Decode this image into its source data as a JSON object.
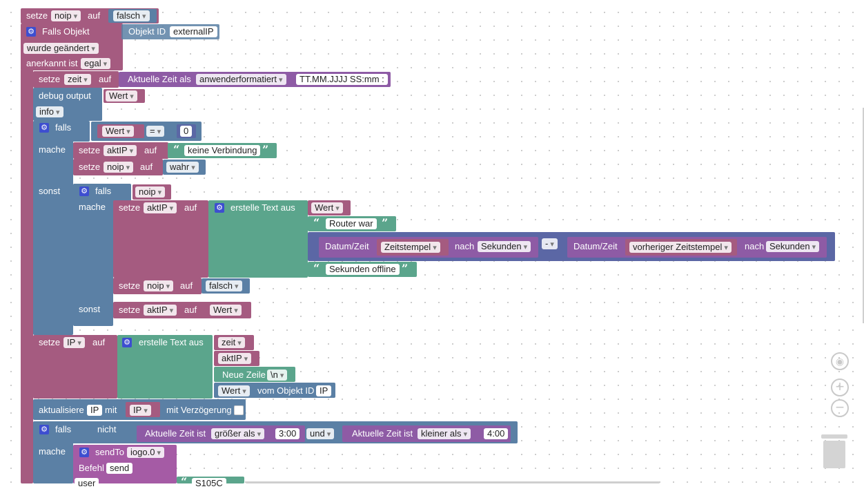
{
  "blocks": {
    "set_noip": {
      "setze": "setze",
      "var": "noip",
      "auf": "auf",
      "value": "falsch"
    },
    "trigger": {
      "label": "Falls Objekt",
      "objekt_id": "Objekt ID",
      "oid": "externalIP",
      "changed": "wurde geändert",
      "ack_label": "anerkannt ist",
      "ack": "egal"
    },
    "set_zeit": {
      "setze": "setze",
      "var": "zeit",
      "auf": "auf",
      "fn": "Aktuelle Zeit als",
      "format": "anwenderformatiert",
      "pattern": "TT.MM.JJJJ SS:mm :"
    },
    "debug": {
      "label": "debug output",
      "value": "Wert",
      "level": "info"
    },
    "if1": {
      "falls": "falls",
      "mache": "mache",
      "sonst": "sonst",
      "lhs": "Wert",
      "op": "=",
      "rhs": "0"
    },
    "set_aktip1": {
      "setze": "setze",
      "var": "aktIP",
      "auf": "auf",
      "text": "keine Verbindung"
    },
    "set_noip_wahr": {
      "setze": "setze",
      "var": "noip",
      "auf": "auf",
      "value": "wahr"
    },
    "if2": {
      "falls": "falls",
      "cond": "noip",
      "mache": "mache",
      "sonst": "sonst"
    },
    "set_aktip2": {
      "setze": "setze",
      "var": "aktIP",
      "auf": "auf",
      "join": "erstelle Text aus",
      "item1": "Wert",
      "item2": "Router war",
      "item4": "Sekunden offline"
    },
    "diff": {
      "dz1": "Datum/Zeit",
      "var1": "Zeitstempel",
      "nach1": "nach",
      "unit1": "Sekunden",
      "op": "-",
      "dz2": "Datum/Zeit",
      "var2": "vorheriger Zeitstempel",
      "nach2": "nach",
      "unit2": "Sekunden"
    },
    "set_noip_falsch": {
      "setze": "setze",
      "var": "noip",
      "auf": "auf",
      "value": "falsch"
    },
    "set_aktip3": {
      "setze": "setze",
      "var": "aktIP",
      "auf": "auf",
      "value": "Wert"
    },
    "set_ip": {
      "setze": "setze",
      "var": "IP",
      "auf": "auf",
      "join": "erstelle Text aus",
      "i1": "zeit",
      "i2": "aktIP",
      "nl": "Neue Zeile",
      "nlv": "\\n",
      "i4": "Wert",
      "vom": "vom Objekt ID",
      "oid": "IP"
    },
    "update": {
      "label": "aktualisiere",
      "target": "IP",
      "mit": "mit",
      "value": "IP",
      "delay": "mit Verzögerung"
    },
    "if3": {
      "falls": "falls",
      "nicht": "nicht",
      "mache": "mache",
      "t1": "Aktuelle Zeit ist",
      "c1": "größer als",
      "v1": "3:00",
      "und": "und",
      "t2": "Aktuelle Zeit ist",
      "c2": "kleiner als",
      "v2": "4:00"
    },
    "sendto": {
      "label": "sendTo",
      "inst": "iogo.0",
      "befehl": "Befehl",
      "cmd": "send",
      "user": "user",
      "partial": "S105C"
    }
  }
}
